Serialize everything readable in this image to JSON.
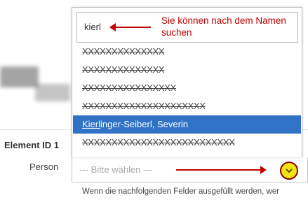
{
  "form": {
    "element_id_label": "Element ID 1",
    "person_label": "Person",
    "select_placeholder": "--- Bitte wählen ---",
    "hint_text": "Wenn die nachfolgenden Felder ausgefüllt werden, wer"
  },
  "dropdown": {
    "search_value": "kierl",
    "search_annotation": "Sie können nach dem Namen suchen",
    "options": [
      {
        "label": "XXXXXXXXXXXXXX",
        "redacted": true
      },
      {
        "label": "XXXXXXXXXXXXXX",
        "redacted": true
      },
      {
        "label": "XXXXXXXXXXXXXXXX",
        "redacted": true
      },
      {
        "label": "XXXXXXXXXXXXXXXXXXXXX",
        "redacted": true
      },
      {
        "label_match": "Kierl",
        "label_rest": "inger-Seiberl, Severin",
        "selected": true
      },
      {
        "label": "XXXXXXXXXXXXXXXXXXXXXXXXXX",
        "redacted": true
      }
    ]
  },
  "colors": {
    "selected_bg": "#2f72c6",
    "annotation": "#c00000",
    "toggle_fill": "#f2e313"
  },
  "icons": {
    "dropdown_toggle": "chevron-down-icon"
  }
}
